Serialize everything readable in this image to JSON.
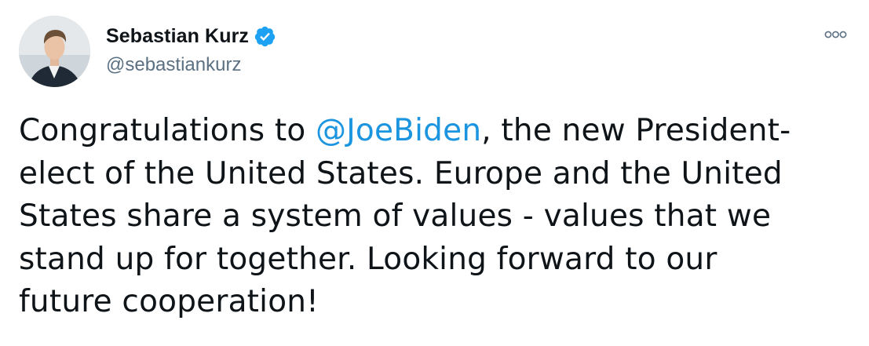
{
  "tweet": {
    "author": {
      "display_name": "Sebastian Kurz",
      "handle": "@sebastiankurz",
      "verified": true
    },
    "text_lines": [
      {
        "before": "Congratulations to ",
        "mention": "@JoeBiden",
        "after": ", the new President-"
      },
      "elect of the United States. Europe and the United",
      "States share a system of values - values that we",
      "stand up for together. Looking forward to our",
      "future cooperation!"
    ],
    "more_icon": "more-dots-icon"
  },
  "colors": {
    "text": "#0f1419",
    "handle": "#5b7083",
    "mention": "#1b95e0",
    "verified": "#1da1f2"
  }
}
